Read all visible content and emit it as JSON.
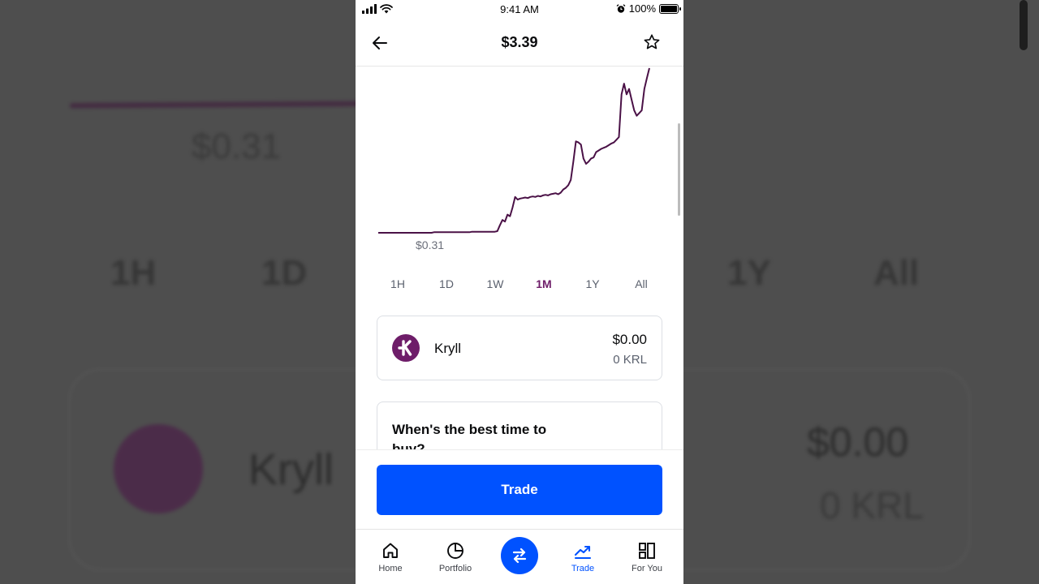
{
  "background": {
    "low_label": "$0.31",
    "tabs": [
      "1H",
      "1D",
      "1Y",
      "All"
    ],
    "asset_name": "Kryll",
    "asset_value": "$0.00",
    "asset_qty": "0 KRL"
  },
  "statusbar": {
    "time": "9:41 AM",
    "battery": "100%"
  },
  "header": {
    "title": "$3.39"
  },
  "chart": {
    "low_label": "$0.31",
    "color": "#4a1146"
  },
  "chart_data": {
    "type": "line",
    "title": "",
    "xlabel": "",
    "ylabel": "",
    "range": "1M",
    "annotations": [
      "$0.31"
    ],
    "values": [
      0.31,
      0.31,
      0.31,
      0.31,
      0.31,
      0.31,
      0.31,
      0.31,
      0.31,
      0.31,
      0.31,
      0.31,
      0.31,
      0.31,
      0.31,
      0.31,
      0.31,
      0.31,
      0.31,
      0.31,
      0.31,
      0.31,
      0.32,
      0.32,
      0.32,
      0.32,
      0.32,
      0.32,
      0.32,
      0.32,
      0.32,
      0.32,
      0.32,
      0.32,
      0.32,
      0.32,
      0.32,
      0.33,
      0.33,
      0.33,
      0.33,
      0.33,
      0.33,
      0.33,
      0.33,
      0.33,
      0.33,
      0.34,
      0.45,
      0.55,
      0.52,
      0.65,
      0.62,
      0.78,
      0.98,
      0.93,
      0.95,
      0.96,
      0.97,
      0.96,
      0.98,
      0.99,
      0.98,
      1.0,
      0.99,
      1.01,
      1.02,
      1.01,
      1.03,
      1.04,
      1.05,
      1.03,
      1.06,
      1.12,
      1.15,
      1.2,
      1.3,
      1.65,
      2.02,
      2.0,
      1.96,
      1.7,
      1.6,
      1.64,
      1.7,
      1.72,
      1.82,
      1.85,
      1.88,
      1.9,
      1.92,
      1.95,
      1.98,
      2.0,
      2.05,
      2.1,
      2.9,
      3.1,
      2.9,
      3.0,
      2.8,
      2.6,
      2.5,
      2.55,
      2.6,
      3.0,
      3.2,
      3.39
    ]
  },
  "ranges": [
    {
      "label": "1H",
      "active": false
    },
    {
      "label": "1D",
      "active": false
    },
    {
      "label": "1W",
      "active": false
    },
    {
      "label": "1M",
      "active": true
    },
    {
      "label": "1Y",
      "active": false
    },
    {
      "label": "All",
      "active": false
    }
  ],
  "asset": {
    "name": "Kryll",
    "value": "$0.00",
    "quantity": "0 KRL",
    "logo_color": "#6e1d69"
  },
  "tip": {
    "title": "When's the best time to buy?"
  },
  "actions": {
    "trade_label": "Trade",
    "trade_color": "#0052ff"
  },
  "tabbar": {
    "items": [
      {
        "label": "Home",
        "icon": "home-icon",
        "active": false
      },
      {
        "label": "Portfolio",
        "icon": "pie-chart-icon",
        "active": false
      },
      {
        "label": "Trade",
        "icon": "trend-up-icon",
        "active": true
      },
      {
        "label": "For You",
        "icon": "grid-icon",
        "active": false
      }
    ],
    "center_icon": "swap-icon"
  }
}
